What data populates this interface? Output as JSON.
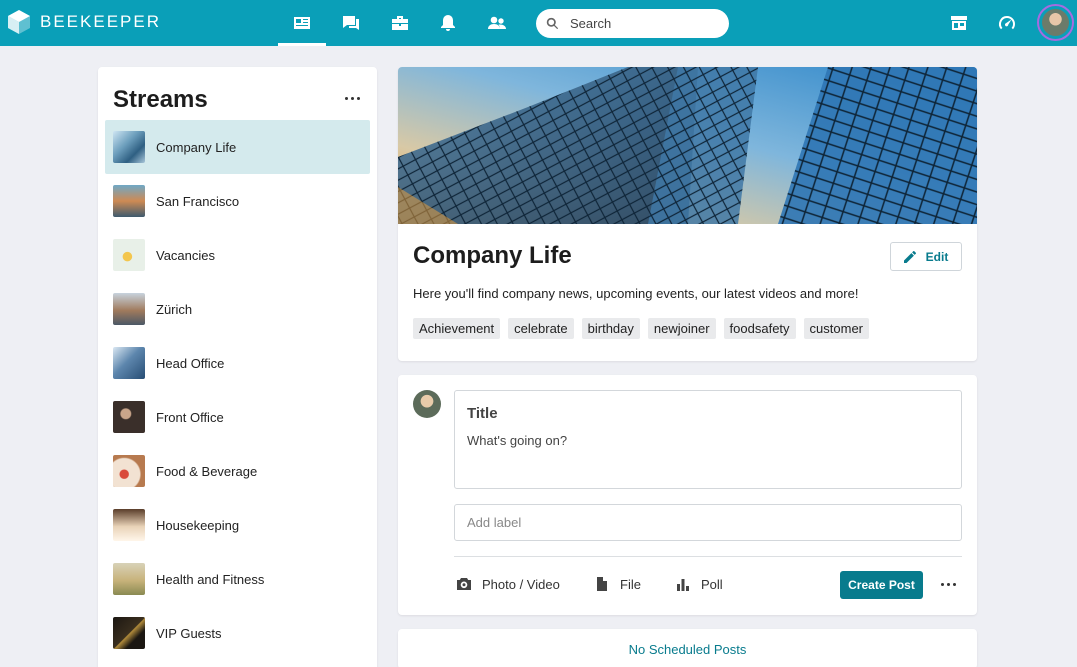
{
  "app": {
    "brand": "BEEKEEPER"
  },
  "search": {
    "placeholder": "Search"
  },
  "nav": {
    "icons": [
      "streams-icon",
      "chat-icon",
      "toolbox-icon",
      "bell-icon",
      "people-icon"
    ],
    "right_icons": [
      "store-icon",
      "dashboard-icon"
    ],
    "accent": "#0a9fb8"
  },
  "sidebar": {
    "title": "Streams",
    "items": [
      {
        "label": "Company Life",
        "active": true
      },
      {
        "label": "San Francisco"
      },
      {
        "label": "Vacancies"
      },
      {
        "label": "Zürich"
      },
      {
        "label": "Head Office"
      },
      {
        "label": "Front Office"
      },
      {
        "label": "Food & Beverage"
      },
      {
        "label": "Housekeeping"
      },
      {
        "label": "Health and Fitness"
      },
      {
        "label": "VIP Guests"
      }
    ]
  },
  "stream": {
    "title": "Company Life",
    "edit_label": "Edit",
    "description": "Here you'll find company news, upcoming events, our latest videos and more!",
    "tags": [
      "Achievement",
      "celebrate",
      "birthday",
      "newjoiner",
      "foodsafety",
      "customer"
    ]
  },
  "composer": {
    "title_placeholder": "Title",
    "body_placeholder": "What's going on?",
    "label_placeholder": "Add label",
    "photo_label": "Photo / Video",
    "file_label": "File",
    "poll_label": "Poll",
    "create_label": "Create Post"
  },
  "scheduled": {
    "label": "No Scheduled Posts"
  },
  "colors": {
    "primary": "#087b8d",
    "active_bg": "#d4eaed"
  }
}
